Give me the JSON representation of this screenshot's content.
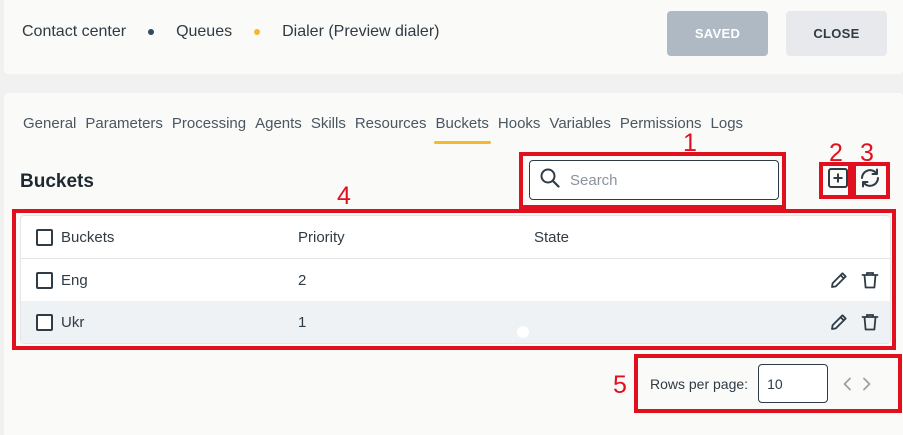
{
  "header": {
    "breadcrumbs": [
      "Contact center",
      "Queues",
      "Dialer (Preview dialer)"
    ],
    "separator_colors": [
      "#2f4a61",
      "#f5b82e"
    ],
    "saved_label": "SAVED",
    "close_label": "CLOSE"
  },
  "tabs": [
    {
      "label": "General"
    },
    {
      "label": "Parameters"
    },
    {
      "label": "Processing"
    },
    {
      "label": "Agents"
    },
    {
      "label": "Skills"
    },
    {
      "label": "Resources"
    },
    {
      "label": "Buckets",
      "active": true
    },
    {
      "label": "Hooks"
    },
    {
      "label": "Variables"
    },
    {
      "label": "Permissions"
    },
    {
      "label": "Logs"
    }
  ],
  "section": {
    "title": "Buckets",
    "search_placeholder": "Search",
    "icons": [
      "search-icon",
      "add-icon",
      "refresh-icon",
      "edit-icon",
      "delete-icon"
    ]
  },
  "table": {
    "columns": [
      "Buckets",
      "Priority",
      "State"
    ],
    "rows": [
      {
        "name": "Eng",
        "priority": "2",
        "enabled": false
      },
      {
        "name": "Ukr",
        "priority": "1",
        "enabled": true
      }
    ]
  },
  "pagination": {
    "label": "Rows per page:",
    "value": "10"
  },
  "annotations": [
    "1",
    "2",
    "3",
    "4",
    "5"
  ],
  "colors": {
    "accent": "#f5b82e",
    "dark": "#2f4a61",
    "annotation": "#e0101e"
  }
}
